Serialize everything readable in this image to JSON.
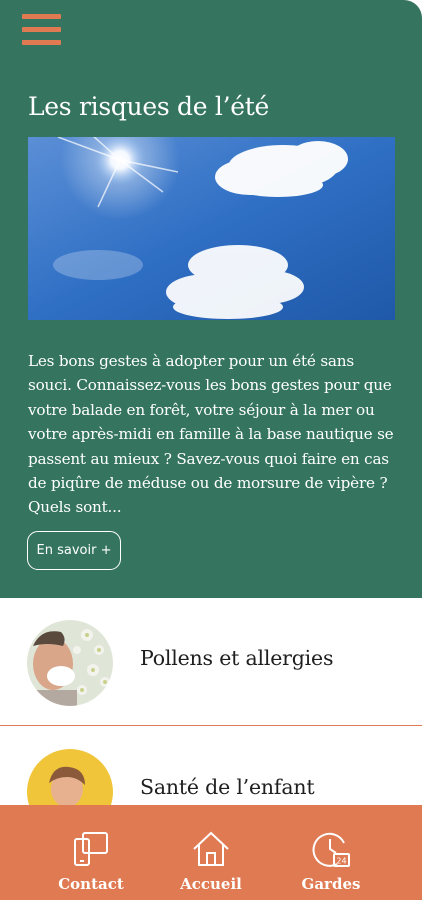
{
  "hero": {
    "title": "Les risques de l’été",
    "description": "Les bons gestes à adopter pour un été sans souci. Connaissez-vous les bons gestes pour que votre balade en forêt, votre séjour à la mer ou votre après-midi en famille à la base nautique se passent au mieux ? Savez-vous quoi faire en cas de piqûre de méduse ou de morsure de vipère ?Quels sont...",
    "more_button": "En savoir +"
  },
  "topics": [
    {
      "title": "Pollens et allergies"
    },
    {
      "title": "Santé de l’enfant"
    }
  ],
  "tabbar": {
    "items": [
      {
        "label": "Contact",
        "icon": "phone-contact-icon"
      },
      {
        "label": "Accueil",
        "icon": "home-icon"
      },
      {
        "label": "Gardes",
        "icon": "clock-24-icon"
      }
    ]
  },
  "colors": {
    "primary_green": "#35755f",
    "accent_orange": "#e07a52",
    "text_dark": "#1f1f1f"
  }
}
